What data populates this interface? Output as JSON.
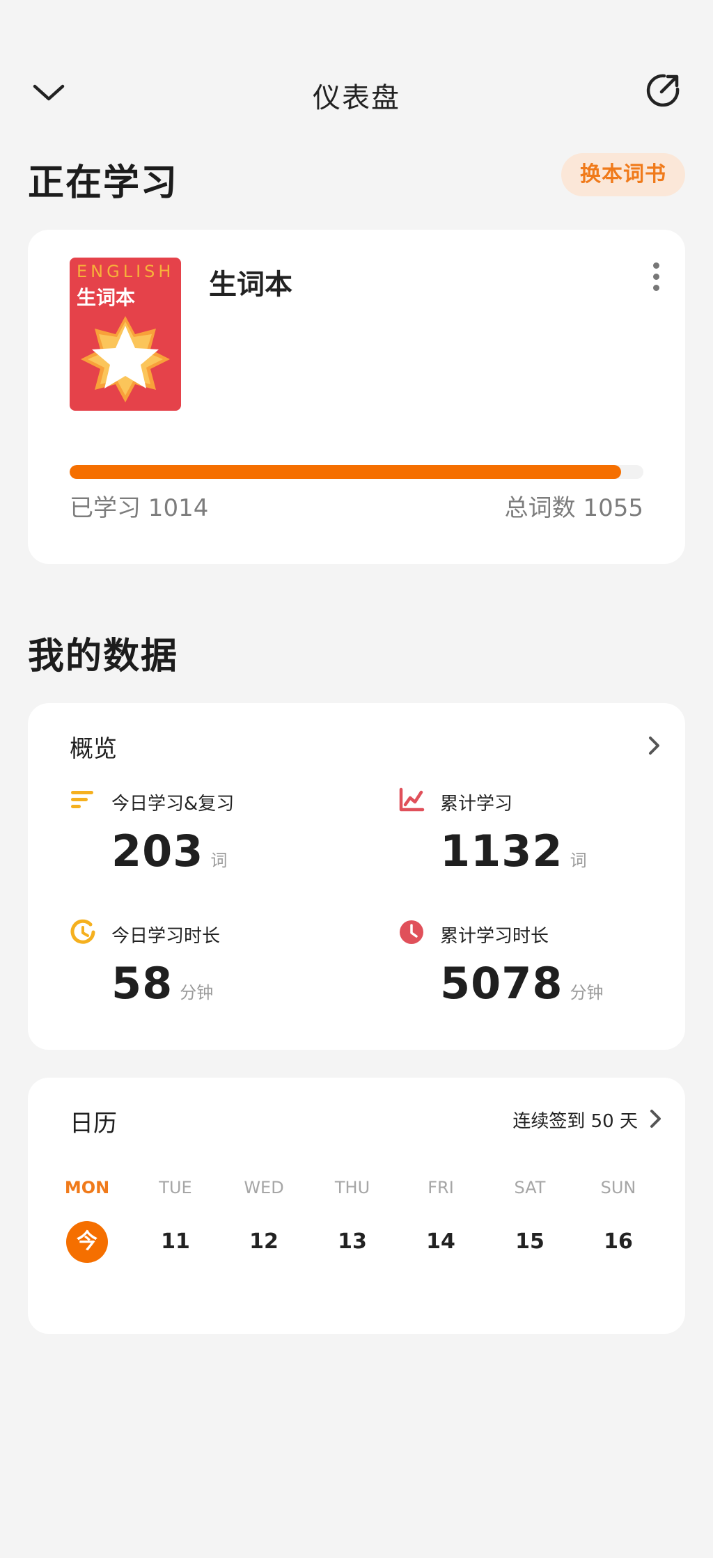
{
  "header": {
    "title": "仪表盘",
    "back_icon": "chevron-down-icon",
    "share_icon": "share-external-icon"
  },
  "learning": {
    "section_title": "正在学习",
    "switch_button": "换本词书",
    "book": {
      "cover_en": "ENGLISH",
      "cover_cn": "生词本",
      "name": "生词本"
    },
    "progress": {
      "learned_label": "已学习 1014",
      "total_label": "总词数 1055",
      "learned": 1014,
      "total": 1055
    }
  },
  "data_section": {
    "section_title": "我的数据"
  },
  "overview": {
    "title": "概览",
    "stats": [
      {
        "label": "今日学习&复习",
        "value": "203",
        "unit": "词",
        "icon": "list-lines-icon",
        "color": "#f5b01f"
      },
      {
        "label": "累计学习",
        "value": "1132",
        "unit": "词",
        "icon": "trend-chart-icon",
        "color": "#e0505a"
      },
      {
        "label": "今日学习时长",
        "value": "58",
        "unit": "分钟",
        "icon": "partial-clock-icon",
        "color": "#f5b01f"
      },
      {
        "label": "累计学习时长",
        "value": "5078",
        "unit": "分钟",
        "icon": "clock-icon",
        "color": "#e0505a"
      }
    ]
  },
  "calendar": {
    "title": "日历",
    "streak": "连续签到 50 天",
    "days": [
      {
        "name": "MON",
        "num": "今",
        "today": true
      },
      {
        "name": "TUE",
        "num": "11"
      },
      {
        "name": "WED",
        "num": "12"
      },
      {
        "name": "THU",
        "num": "13"
      },
      {
        "name": "FRI",
        "num": "14"
      },
      {
        "name": "SAT",
        "num": "15"
      },
      {
        "name": "SUN",
        "num": "16"
      }
    ]
  },
  "colors": {
    "accent": "#f56f00",
    "accent_soft": "#fbe7d8",
    "background": "#f4f4f4",
    "card": "#ffffff"
  }
}
